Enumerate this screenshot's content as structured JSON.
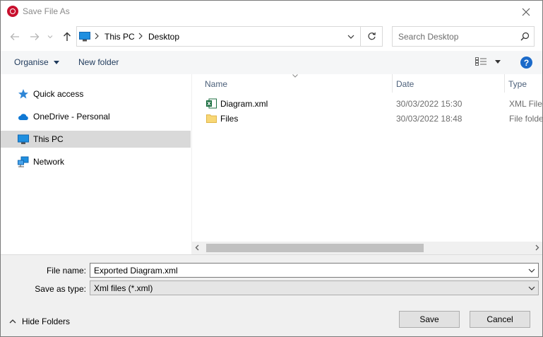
{
  "window": {
    "title": "Save File As"
  },
  "address": {
    "crumbs": [
      "This PC",
      "Desktop"
    ]
  },
  "search": {
    "placeholder": "Search Desktop"
  },
  "toolbar": {
    "organise_label": "Organise",
    "new_folder_label": "New folder",
    "help_label": "?"
  },
  "nav": {
    "items": [
      {
        "label": "Quick access",
        "icon": "star-icon"
      },
      {
        "label": "OneDrive - Personal",
        "icon": "cloud-icon"
      },
      {
        "label": "This PC",
        "icon": "computer-icon",
        "selected": true
      },
      {
        "label": "Network",
        "icon": "network-icon"
      }
    ]
  },
  "columns": {
    "name": "Name",
    "date": "Date",
    "type": "Type"
  },
  "files": [
    {
      "name": "Diagram.xml",
      "date": "30/03/2022 15:30",
      "type": "XML File",
      "icon": "excel-icon"
    },
    {
      "name": "Files",
      "date": "30/03/2022 18:48",
      "type": "File folder",
      "icon": "folder-icon"
    }
  ],
  "form": {
    "file_name_label": "File name:",
    "file_name_value": "Exported Diagram.xml",
    "save_type_label": "Save as type:",
    "save_type_value": "Xml files (*.xml)"
  },
  "footer": {
    "hide_folders_label": "Hide Folders",
    "save_label": "Save",
    "cancel_label": "Cancel"
  },
  "colors": {
    "accent": "#1b6ac9",
    "selection": "#d9d9d9",
    "toolbar_text": "#1e395b"
  }
}
